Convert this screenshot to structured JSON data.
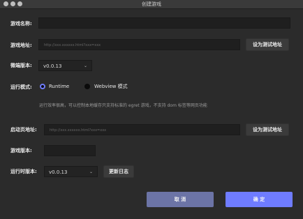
{
  "window": {
    "title": "创建游戏"
  },
  "form": {
    "game_name": {
      "label": "游戏名称:",
      "value": ""
    },
    "game_url": {
      "label": "游戏地址:",
      "placeholder": "http://xxx.xxxxxx.html?xxx=xxx",
      "set_test_button": "设为测试地址"
    },
    "micro_version": {
      "label": "微端版本:",
      "selected": "v0.0.13"
    },
    "run_mode": {
      "label": "运行模式:",
      "options": [
        {
          "label": "Runtime",
          "selected": true
        },
        {
          "label": "Webview 模式",
          "selected": false
        }
      ],
      "hint": "运行效率很高，可以控制本地缓存只支持标准的 egret 游戏，不支持 dom 标签等网页功能"
    },
    "launch_url": {
      "label": "启动页地址:",
      "placeholder": "http://xxx.xxxxxx.html?xxx=xxx",
      "set_test_button": "设为测试地址"
    },
    "game_version": {
      "label": "游戏版本:",
      "value": ""
    },
    "runtime_version": {
      "label": "运行时版本:",
      "selected": "v0.0.13",
      "update_log_button": "更新日志"
    }
  },
  "footer": {
    "cancel_label": "取 消",
    "ok_label": "确 定"
  },
  "colors": {
    "accent": "#6f7cff",
    "cancel": "#6c74a6",
    "background": "#2b2b2b",
    "input": "#1f1f1f"
  }
}
